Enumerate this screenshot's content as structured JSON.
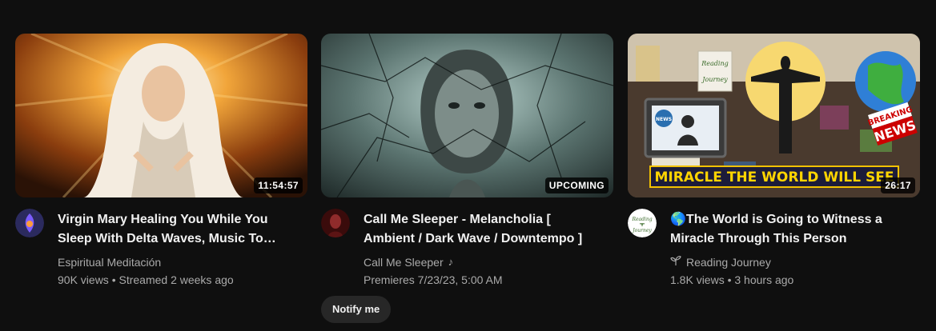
{
  "videos": [
    {
      "duration": "11:54:57",
      "title": "Virgin Mary Healing You While You Sleep With Delta Waves, Music To…",
      "channel": "Espiritual Meditación",
      "views": "90K views",
      "age": "Streamed 2 weeks ago",
      "stats": "90K views • Streamed 2 weeks ago"
    },
    {
      "badge": "UPCOMING",
      "title": "Call Me Sleeper - Melancholia [ Ambient / Dark Wave / Downtempo ]",
      "channel": "Call Me Sleeper",
      "channel_icon": "music-note-icon",
      "premiere": "Premieres 7/23/23, 5:00 AM",
      "notify_label": "Notify me"
    },
    {
      "duration": "26:17",
      "title": "🌎The World is Going to Witness a Miracle Through This Person",
      "channel": "Reading Journey",
      "channel_icon": "sprout-icon",
      "stats": "1.8K views • 3 hours ago",
      "thumb_text": {
        "banner": "MIRACLE THE WORLD WILL SEE",
        "sign": "Reading Journey",
        "news": "NEWS",
        "breaking": "BREAKING",
        "breaking_news": "NEWS"
      },
      "avatar_text": "Reading Journey"
    }
  ],
  "colors": {
    "background": "#0f0f0f",
    "badge_bg": "#000000cc",
    "secondary_text": "#aaaaaa",
    "button_bg": "#272727"
  }
}
